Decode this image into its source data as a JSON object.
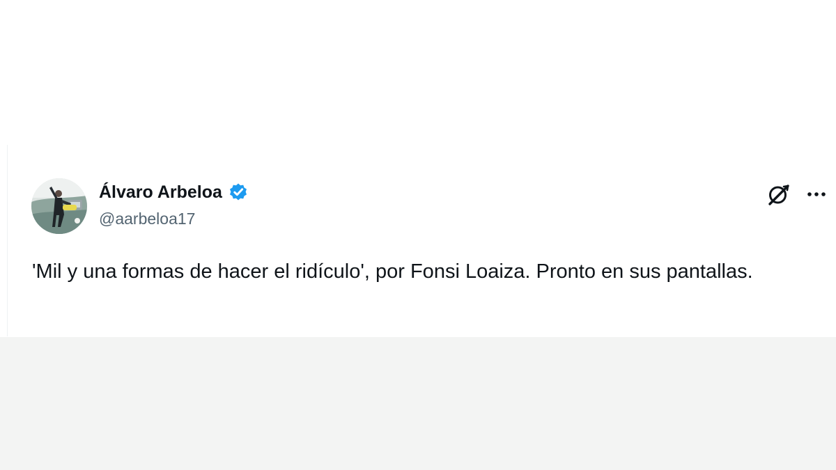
{
  "tweet": {
    "author": {
      "display_name": "Álvaro Arbeloa",
      "handle": "@aarbeloa17",
      "verified": true
    },
    "text": "'Mil y una formas de hacer el ridículo', por Fonsi Loaiza. Pronto en sus pantallas.",
    "actions": {
      "grok_icon": "grok-icon",
      "more_icon": "more-options-icon"
    }
  },
  "colors": {
    "verified_badge": "#1d9bf0",
    "text_primary": "#0f1419",
    "text_secondary": "#536471",
    "lower_background": "#f3f4f3"
  }
}
